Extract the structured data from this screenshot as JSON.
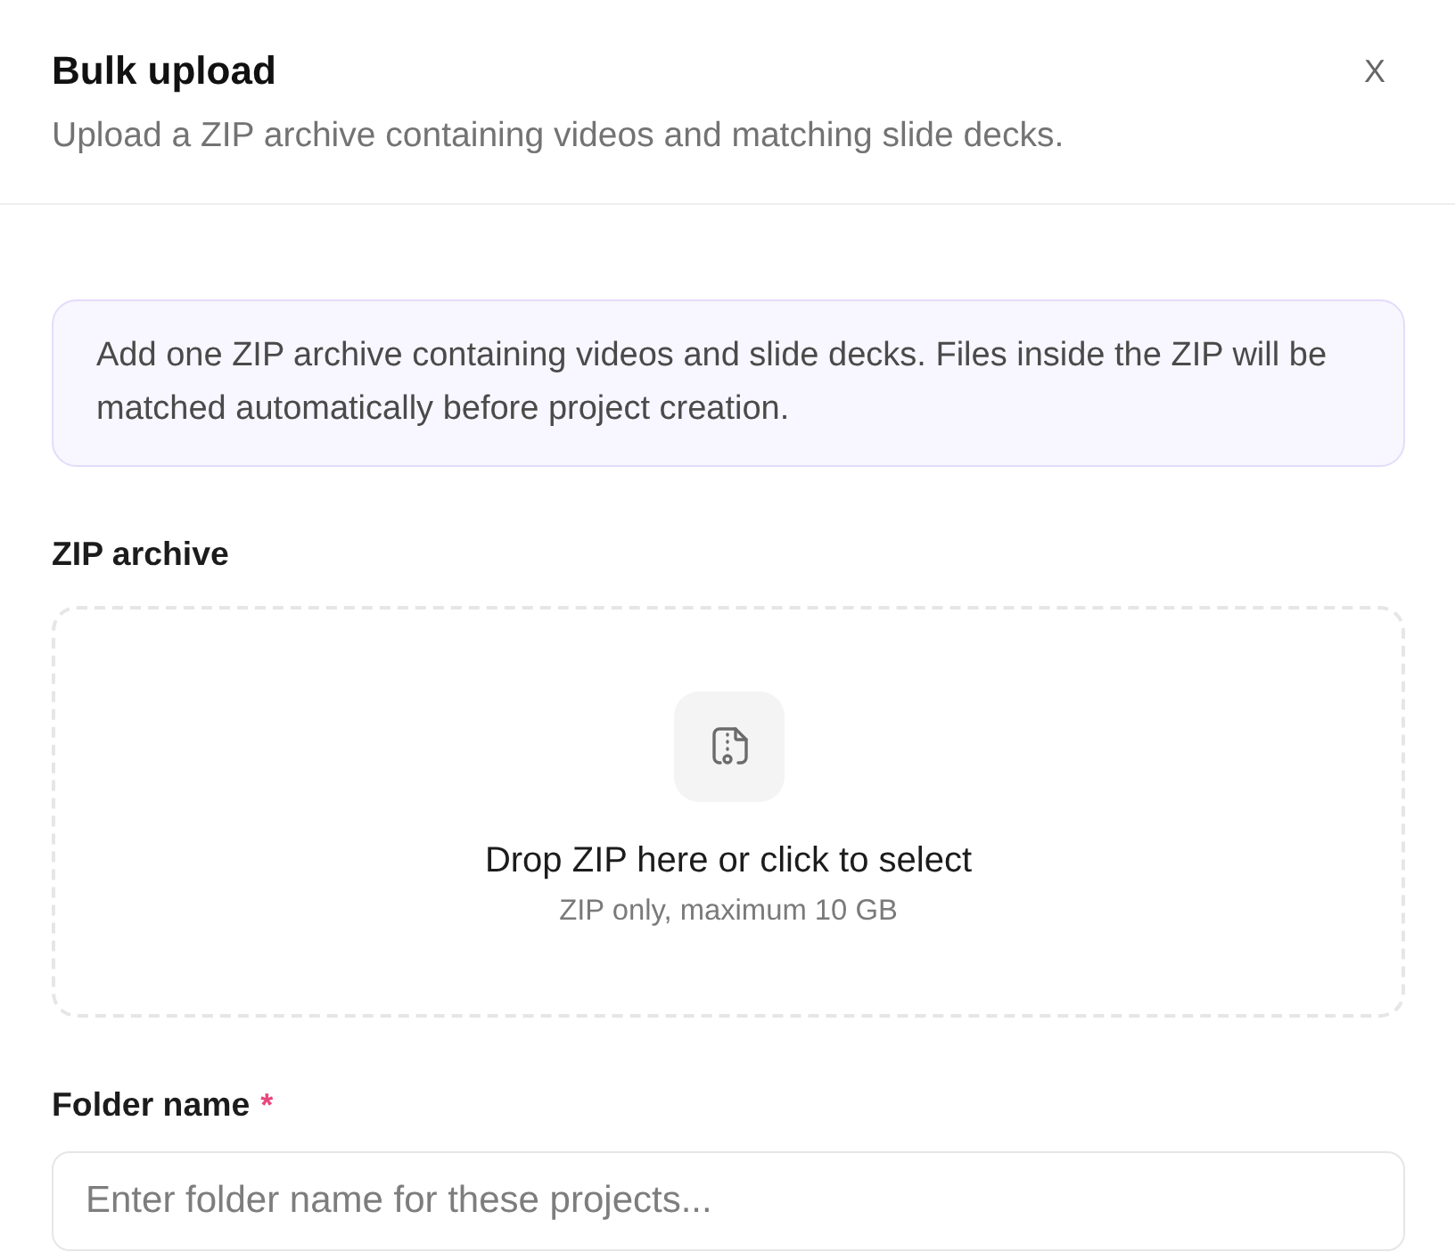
{
  "dialog": {
    "title": "Bulk upload",
    "subtitle": "Upload a ZIP archive containing videos and matching slide decks.",
    "close_label": "X"
  },
  "notice": {
    "text": "Add one ZIP archive containing videos and slide decks. Files inside the ZIP will be matched automatically before project creation."
  },
  "zip_field": {
    "label": "ZIP archive",
    "dropzone": {
      "title": "Drop ZIP here or click to select",
      "hint": "ZIP only, maximum 10 GB"
    }
  },
  "folder_field": {
    "label": "Folder name",
    "required_mark": "*",
    "placeholder": "Enter folder name for these projects..."
  }
}
